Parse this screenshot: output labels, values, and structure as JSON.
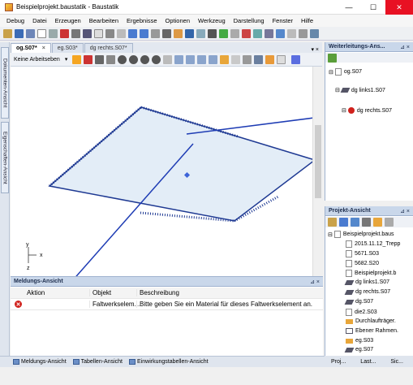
{
  "window": {
    "title": "Beispielprojekt.baustatik - Baustatik",
    "minimize": "—",
    "maximize": "☐",
    "close": "✕"
  },
  "menu": [
    "Debug",
    "Datei",
    "Erzeugen",
    "Bearbeiten",
    "Ergebnisse",
    "Optionen",
    "Werkzeug",
    "Darstellung",
    "Fenster",
    "Hilfe"
  ],
  "left_tabs": {
    "dokumente": "Dokumenten-Ansicht",
    "eigenschaften": "Eigenschaften-Ansicht"
  },
  "doc_tabs": [
    {
      "label": "og.S07*"
    },
    {
      "label": "eg.S03*"
    },
    {
      "label": "dg rechts.S07*"
    }
  ],
  "view_toolbar": {
    "workplane": "Keine Arbeitseben"
  },
  "axes": {
    "x": "x",
    "y": "y",
    "z": "z"
  },
  "meldungen": {
    "title": "Meldungs-Ansicht",
    "headers": [
      "Aktion",
      "Objekt",
      "Beschreibung"
    ],
    "rows": [
      {
        "objekt": "Faltwerkselem...",
        "beschreibung": "Bitte geben Sie ein Material für dieses Faltwerkselement an."
      }
    ]
  },
  "bottom_tabs": [
    "Meldungs-Ansicht",
    "Tabellen-Ansicht",
    "Einwirkungstabellen-Ansicht"
  ],
  "weiterleitungs": {
    "title": "Weiterleitungs-Ans...",
    "root": "og.S07",
    "items": [
      "dg links1.S07",
      "dg rechts.S07"
    ]
  },
  "projekt": {
    "title": "Projekt-Ansicht",
    "items": [
      "Beispielprojekt.baus",
      "2015.11.12_Trepp",
      "5671.S03",
      "5682.S20",
      "Beispielprojekt.b",
      "dg links1.S07",
      "dg rechts.S07",
      "dg.S07",
      "die2.S03",
      "Durchlaufträger.",
      "Ebener Rahmen.",
      "eg.S03",
      "eg.S07"
    ]
  },
  "right_bottom_tabs": [
    "Proj...",
    "Last...",
    "Sic..."
  ],
  "colors": {
    "slab_fill": "#e3edf7",
    "slab_edge": "#1f3a93",
    "arrow": "#1e3cb4",
    "error": "#d0211c"
  }
}
